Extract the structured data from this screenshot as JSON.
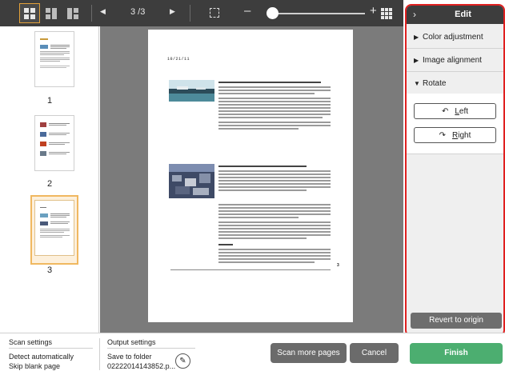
{
  "toolbar": {
    "page_indicator": "3 /3",
    "view_modes": [
      "grid-view-icon",
      "split-view-icon",
      "double-view-icon"
    ],
    "icons": [
      "prev-page-icon",
      "next-page-icon",
      "fit-page-icon",
      "zoom-out-icon",
      "zoom-in-icon",
      "thumbnail-grid-icon"
    ],
    "zoom_level": 0.05
  },
  "thumbnails": {
    "items": [
      {
        "label": "1"
      },
      {
        "label": "2"
      },
      {
        "label": "3",
        "selected": true
      }
    ]
  },
  "document": {
    "date": "10/21/11",
    "page_number": "3"
  },
  "edit_panel": {
    "title": "Edit",
    "sections": {
      "color_adjustment": "Color adjustment",
      "image_alignment": "Image alignment",
      "rotate": "Rotate"
    },
    "rotate_left_prefix": "L",
    "rotate_left_rest": "eft",
    "rotate_right_prefix": "R",
    "rotate_right_rest": "ight",
    "revert": "Revert to origin"
  },
  "bottom_bar": {
    "scan_settings_title": "Scan settings",
    "scan_setting_1": "Detect automatically",
    "scan_setting_2": "Skip blank page",
    "output_settings_title": "Output settings",
    "output_setting_1": "Save to folder",
    "output_setting_2": "02222014143852.p...",
    "scan_more": "Scan more pages",
    "cancel": "Cancel",
    "finish": "Finish"
  },
  "colors": {
    "toolbar_bg": "#3d3d3d",
    "accent_orange": "#e3a13a",
    "highlight_red": "#e02020",
    "finish_green": "#4cae70",
    "button_gray": "#6b6b6b"
  }
}
